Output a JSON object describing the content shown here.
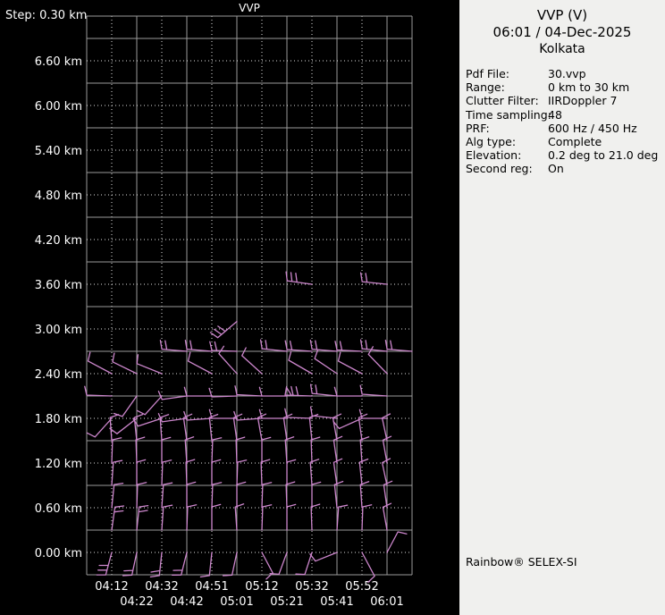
{
  "panel": {
    "title": "VVP (V)",
    "datetime": "06:01 / 04-Dec-2025",
    "site": "Kolkata",
    "params": [
      {
        "label": "Pdf File:",
        "value": "30.vvp"
      },
      {
        "label": "Range:",
        "value": "0 km to 30 km"
      },
      {
        "label": "Clutter Filter:",
        "value": "IIRDoppler 7"
      },
      {
        "label": "Time sampling:",
        "value": "48"
      },
      {
        "label": "PRF:",
        "value": "600 Hz / 450 Hz"
      },
      {
        "label": "Alg type:",
        "value": "Complete"
      },
      {
        "label": "Elevation:",
        "value": "0.2 deg to 21.0 deg"
      },
      {
        "label": "Second reg:",
        "value": "On"
      }
    ],
    "footer": "Rainbow® SELEX-SI"
  },
  "chart_data": {
    "type": "wind-barb-profile",
    "title": "VVP",
    "step_label": "Step: 0.30 km",
    "ylabel": "km",
    "ylim": [
      0.0,
      7.2
    ],
    "step_km": 0.3,
    "grid": "on",
    "altitude_labels": [
      "6.60 km",
      "6.00 km",
      "5.40 km",
      "4.80 km",
      "4.20 km",
      "3.60 km",
      "3.00 km",
      "2.40 km",
      "1.80 km",
      "1.20 km",
      "0.60 km",
      "0.00 km"
    ],
    "times": [
      "04:12",
      "04:22",
      "04:32",
      "04:42",
      "04:51",
      "05:01",
      "05:12",
      "05:21",
      "05:32",
      "05:41",
      "05:52",
      "06:01"
    ],
    "colors": {
      "background": "#000000",
      "grid_solid": "#9a9a9a",
      "grid_dotted": "#e0e0e0",
      "barb": "#cd87cd",
      "text": "#ffffff",
      "panel_bg": "#f0f0ee",
      "panel_text": "#000000"
    },
    "barbs": [
      {
        "i": 9,
        "a": 3.6,
        "d": 278,
        "t": 3,
        "l": 28
      },
      {
        "i": 12,
        "a": 3.6,
        "d": 276,
        "t": 2,
        "l": 28
      },
      {
        "i": 6,
        "a": 3.1,
        "d": 230,
        "t": 3,
        "l": 28
      },
      {
        "i": 4,
        "a": 2.7,
        "d": 275,
        "t": 2,
        "l": 28
      },
      {
        "i": 5,
        "a": 2.7,
        "d": 275,
        "t": 2,
        "l": 28
      },
      {
        "i": 6,
        "a": 2.7,
        "d": 272,
        "t": 2,
        "l": 28
      },
      {
        "i": 8,
        "a": 2.7,
        "d": 276,
        "t": 2,
        "l": 28
      },
      {
        "i": 9,
        "a": 2.7,
        "d": 274,
        "t": 2,
        "l": 28
      },
      {
        "i": 10,
        "a": 2.7,
        "d": 275,
        "t": 2,
        "l": 28
      },
      {
        "i": 11,
        "a": 2.7,
        "d": 273,
        "t": 2,
        "l": 28
      },
      {
        "i": 12,
        "a": 2.7,
        "d": 276,
        "t": 2,
        "l": 28
      },
      {
        "i": 13,
        "a": 2.7,
        "d": 275,
        "t": 2,
        "l": 28
      },
      {
        "i": 1,
        "a": 2.4,
        "d": 298,
        "t": 1,
        "l": 30
      },
      {
        "i": 2,
        "a": 2.4,
        "d": 296,
        "t": 1,
        "l": 30
      },
      {
        "i": 3,
        "a": 2.4,
        "d": 292,
        "t": 1,
        "l": 30
      },
      {
        "i": 5,
        "a": 2.4,
        "d": 298,
        "t": 1,
        "l": 30
      },
      {
        "i": 6,
        "a": 2.4,
        "d": 318,
        "t": 1,
        "l": 30
      },
      {
        "i": 7,
        "a": 2.4,
        "d": 312,
        "t": 1,
        "l": 30
      },
      {
        "i": 9,
        "a": 2.4,
        "d": 300,
        "t": 1,
        "l": 30
      },
      {
        "i": 10,
        "a": 2.4,
        "d": 304,
        "t": 1,
        "l": 30
      },
      {
        "i": 11,
        "a": 2.4,
        "d": 298,
        "t": 1,
        "l": 30
      },
      {
        "i": 12,
        "a": 2.4,
        "d": 316,
        "t": 1,
        "l": 30
      },
      {
        "i": 1,
        "a": 2.1,
        "d": 272,
        "t": 1,
        "l": 28
      },
      {
        "i": 2,
        "a": 2.1,
        "d": 215,
        "t": 1,
        "l": 28
      },
      {
        "i": 3,
        "a": 2.1,
        "d": 222,
        "t": 1,
        "l": 28
      },
      {
        "i": 4,
        "a": 2.1,
        "d": 262,
        "t": 1,
        "l": 28
      },
      {
        "i": 5,
        "a": 2.1,
        "d": 270,
        "t": 1,
        "l": 28
      },
      {
        "i": 6,
        "a": 2.1,
        "d": 268,
        "t": 1,
        "l": 28
      },
      {
        "i": 7,
        "a": 2.1,
        "d": 273,
        "t": 1,
        "l": 28
      },
      {
        "i": 8,
        "a": 2.1,
        "d": 270,
        "t": 1,
        "l": 28
      },
      {
        "i": 9,
        "a": 2.1,
        "d": 272,
        "t": 2,
        "p": 1,
        "l": 30
      },
      {
        "i": 10,
        "a": 2.1,
        "d": 276,
        "t": 2,
        "l": 28
      },
      {
        "i": 11,
        "a": 2.1,
        "d": 270,
        "t": 1,
        "l": 28
      },
      {
        "i": 12,
        "a": 2.1,
        "d": 274,
        "t": 1,
        "l": 28
      },
      {
        "i": 1,
        "a": 1.8,
        "d": 222,
        "t": 1,
        "l": 28
      },
      {
        "i": 2,
        "a": 1.8,
        "d": 232,
        "t": 1,
        "l": 28
      },
      {
        "i": 3,
        "a": 1.8,
        "d": 252,
        "t": 1,
        "l": 28
      },
      {
        "i": 4,
        "a": 1.8,
        "d": 262,
        "t": 1,
        "l": 28
      },
      {
        "i": 5,
        "a": 1.8,
        "d": 266,
        "t": 1,
        "l": 28
      },
      {
        "i": 6,
        "a": 1.8,
        "d": 270,
        "t": 1,
        "l": 28
      },
      {
        "i": 7,
        "a": 1.8,
        "d": 266,
        "t": 1,
        "l": 28
      },
      {
        "i": 8,
        "a": 1.8,
        "d": 270,
        "t": 1,
        "l": 28
      },
      {
        "i": 9,
        "a": 1.8,
        "d": 272,
        "t": 1,
        "l": 28
      },
      {
        "i": 10,
        "a": 1.8,
        "d": 276,
        "t": 1,
        "l": 28
      },
      {
        "i": 11,
        "a": 1.8,
        "d": 246,
        "t": 1,
        "l": 28
      },
      {
        "i": 12,
        "a": 1.8,
        "d": 270,
        "t": 1,
        "l": 28
      },
      {
        "i": 1,
        "a": 1.5,
        "d": 356,
        "t": 1
      },
      {
        "i": 2,
        "a": 1.5,
        "d": 354,
        "t": 1
      },
      {
        "i": 3,
        "a": 1.5,
        "d": 356,
        "t": 1
      },
      {
        "i": 4,
        "a": 1.5,
        "d": 352,
        "t": 1
      },
      {
        "i": 5,
        "a": 1.5,
        "d": 354,
        "t": 1
      },
      {
        "i": 6,
        "a": 1.5,
        "d": 352,
        "t": 1
      },
      {
        "i": 7,
        "a": 1.5,
        "d": 350,
        "t": 1
      },
      {
        "i": 8,
        "a": 1.5,
        "d": 352,
        "t": 1
      },
      {
        "i": 9,
        "a": 1.5,
        "d": 354,
        "t": 1
      },
      {
        "i": 10,
        "a": 1.5,
        "d": 350,
        "t": 1
      },
      {
        "i": 11,
        "a": 1.5,
        "d": 352,
        "t": 1
      },
      {
        "i": 12,
        "a": 1.5,
        "d": 348,
        "t": 1
      },
      {
        "i": 1,
        "a": 1.2,
        "d": 2,
        "t": 1
      },
      {
        "i": 2,
        "a": 1.2,
        "d": 358,
        "t": 1
      },
      {
        "i": 3,
        "a": 1.2,
        "d": 0,
        "t": 1
      },
      {
        "i": 4,
        "a": 1.2,
        "d": 356,
        "t": 1
      },
      {
        "i": 5,
        "a": 1.2,
        "d": 2,
        "t": 1
      },
      {
        "i": 6,
        "a": 1.2,
        "d": 358,
        "t": 1
      },
      {
        "i": 7,
        "a": 1.2,
        "d": 0,
        "t": 1
      },
      {
        "i": 8,
        "a": 1.2,
        "d": 356,
        "t": 1
      },
      {
        "i": 9,
        "a": 1.2,
        "d": 358,
        "t": 1
      },
      {
        "i": 10,
        "a": 1.2,
        "d": 352,
        "t": 1
      },
      {
        "i": 11,
        "a": 1.2,
        "d": 356,
        "t": 1
      },
      {
        "i": 12,
        "a": 1.2,
        "d": 350,
        "t": 1
      },
      {
        "i": 1,
        "a": 0.9,
        "d": 4,
        "t": 1
      },
      {
        "i": 2,
        "a": 0.9,
        "d": 0,
        "t": 1
      },
      {
        "i": 3,
        "a": 0.9,
        "d": 2,
        "t": 1
      },
      {
        "i": 4,
        "a": 0.9,
        "d": 358,
        "t": 1
      },
      {
        "i": 5,
        "a": 0.9,
        "d": 0,
        "t": 1
      },
      {
        "i": 6,
        "a": 0.9,
        "d": 2,
        "t": 1
      },
      {
        "i": 7,
        "a": 0.9,
        "d": 358,
        "t": 1
      },
      {
        "i": 8,
        "a": 0.9,
        "d": 0,
        "t": 1
      },
      {
        "i": 9,
        "a": 0.9,
        "d": 356,
        "t": 1
      },
      {
        "i": 10,
        "a": 0.9,
        "d": 352,
        "t": 1
      },
      {
        "i": 11,
        "a": 0.9,
        "d": 354,
        "t": 1
      },
      {
        "i": 12,
        "a": 0.9,
        "d": 348,
        "t": 1
      },
      {
        "i": 1,
        "a": 0.6,
        "d": 6,
        "t": 1
      },
      {
        "i": 2,
        "a": 0.6,
        "d": 2,
        "t": 1
      },
      {
        "i": 3,
        "a": 0.6,
        "d": 4,
        "t": 1
      },
      {
        "i": 4,
        "a": 0.6,
        "d": 0,
        "t": 1
      },
      {
        "i": 5,
        "a": 0.6,
        "d": 2,
        "t": 1
      },
      {
        "i": 6,
        "a": 0.6,
        "d": 0,
        "t": 1
      },
      {
        "i": 7,
        "a": 0.6,
        "d": 2,
        "t": 1
      },
      {
        "i": 8,
        "a": 0.6,
        "d": 358,
        "t": 1
      },
      {
        "i": 9,
        "a": 0.6,
        "d": 0,
        "t": 1
      },
      {
        "i": 10,
        "a": 0.6,
        "d": 354,
        "t": 1
      },
      {
        "i": 11,
        "a": 0.6,
        "d": 356,
        "t": 1
      },
      {
        "i": 12,
        "a": 0.6,
        "d": 352,
        "t": 1
      },
      {
        "i": 1,
        "a": 0.3,
        "d": 8,
        "t": 2
      },
      {
        "i": 2,
        "a": 0.3,
        "d": 6,
        "t": 2
      },
      {
        "i": 3,
        "a": 0.3,
        "d": 4,
        "t": 1
      },
      {
        "i": 4,
        "a": 0.3,
        "d": 2,
        "t": 1
      },
      {
        "i": 5,
        "a": 0.3,
        "d": 0,
        "t": 1
      },
      {
        "i": 6,
        "a": 0.3,
        "d": 356,
        "t": 1
      },
      {
        "i": 7,
        "a": 0.3,
        "d": 2,
        "t": 1
      },
      {
        "i": 8,
        "a": 0.3,
        "d": 0,
        "t": 1
      },
      {
        "i": 9,
        "a": 0.3,
        "d": 358,
        "t": 1
      },
      {
        "i": 10,
        "a": 0.3,
        "d": 4,
        "t": 1
      },
      {
        "i": 11,
        "a": 0.3,
        "d": 2,
        "t": 1
      },
      {
        "i": 12,
        "a": 0.3,
        "d": 350,
        "t": 1
      },
      {
        "i": 1,
        "a": 0.0,
        "d": 195,
        "t": 3
      },
      {
        "i": 2,
        "a": 0.0,
        "d": 192,
        "t": 2
      },
      {
        "i": 3,
        "a": 0.0,
        "d": 186,
        "t": 2
      },
      {
        "i": 4,
        "a": 0.0,
        "d": 194,
        "t": 2
      },
      {
        "i": 5,
        "a": 0.0,
        "d": 186,
        "t": 1
      },
      {
        "i": 6,
        "a": 0.0,
        "d": 192,
        "t": 1
      },
      {
        "i": 7,
        "a": 0.0,
        "d": 152,
        "t": 1
      },
      {
        "i": 8,
        "a": 0.0,
        "d": 200,
        "t": 1
      },
      {
        "i": 9,
        "a": 0.0,
        "d": 198,
        "t": 1
      },
      {
        "i": 10,
        "a": 0.0,
        "d": 248,
        "t": 1
      },
      {
        "i": 11,
        "a": 0.0,
        "d": 152,
        "t": 1,
        "l": 30
      },
      {
        "i": 12,
        "a": 0.0,
        "d": 28,
        "t": 1
      }
    ]
  }
}
